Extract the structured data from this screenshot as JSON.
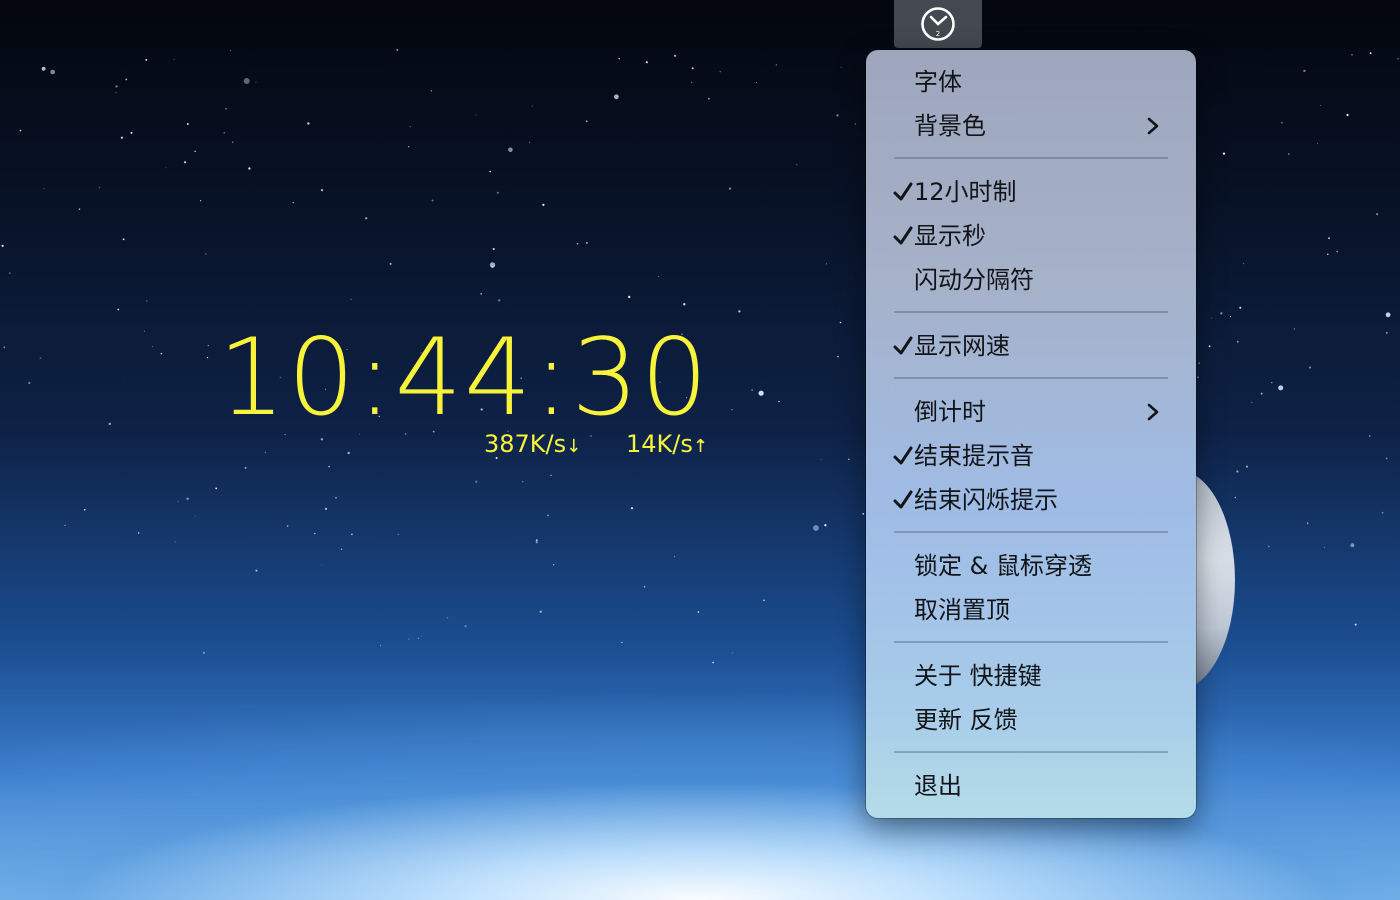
{
  "menubar": {
    "status_icon": "clock-icon"
  },
  "clock": {
    "time": "10:44:30",
    "download_speed": "387K/s",
    "download_arrow": "↓",
    "upload_speed": "14K/s",
    "upload_arrow": "↑",
    "color": "#f7f23a"
  },
  "menu": {
    "items": [
      {
        "label": "字体",
        "checked": false,
        "submenu": false
      },
      {
        "label": "背景色",
        "checked": false,
        "submenu": true
      },
      {
        "label": "12小时制",
        "checked": true,
        "submenu": false
      },
      {
        "label": "显示秒",
        "checked": true,
        "submenu": false
      },
      {
        "label": "闪动分隔符",
        "checked": false,
        "submenu": false
      },
      {
        "label": "显示网速",
        "checked": true,
        "submenu": false
      },
      {
        "label": "倒计时",
        "checked": false,
        "submenu": true
      },
      {
        "label": "结束提示音",
        "checked": true,
        "submenu": false
      },
      {
        "label": "结束闪烁提示",
        "checked": true,
        "submenu": false
      },
      {
        "label": "锁定 & 鼠标穿透",
        "checked": false,
        "submenu": false
      },
      {
        "label": "取消置顶",
        "checked": false,
        "submenu": false
      },
      {
        "label": "关于 快捷键",
        "checked": false,
        "submenu": false
      },
      {
        "label": "更新 反馈",
        "checked": false,
        "submenu": false
      },
      {
        "label": "退出",
        "checked": false,
        "submenu": false
      }
    ]
  }
}
